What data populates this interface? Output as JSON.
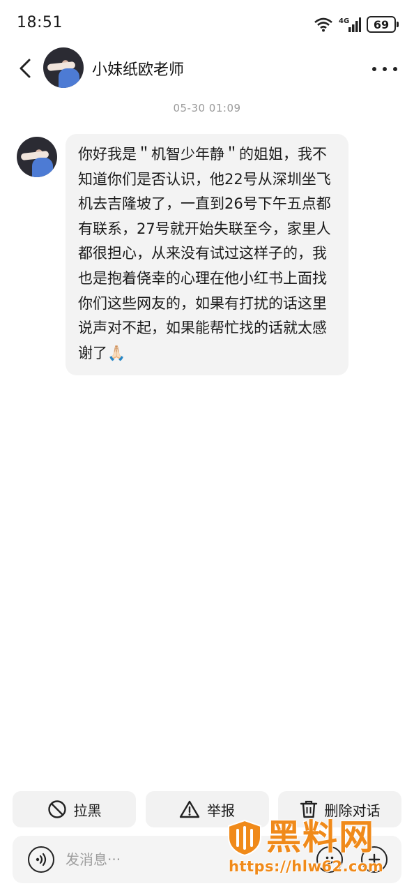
{
  "status_bar": {
    "time": "18:51",
    "signal_text": "4G",
    "battery": "69"
  },
  "header": {
    "contact_name": "小妹纸欧老师",
    "back_icon": "chevron-left-icon",
    "more_icon": "more-horizontal-icon"
  },
  "conversation": {
    "timestamp": "05-30 01:09",
    "messages": [
      {
        "sender": "contact",
        "text": "你好我是＂机智少年静＂的姐姐，我不知道你们是否认识，他22号从深圳坐飞机去吉隆坡了，一直到26号下午五点都有联系，27号就开始失联至今，家里人都很担心，从来没有试过这样子的，我也是抱着侥幸的心理在他小红书上面找你们这些网友的，如果有打扰的话这里说声对不起，如果能帮忙找的话就太感谢了🙏🏻"
      }
    ]
  },
  "actions": {
    "block_label": "拉黑",
    "report_label": "举报",
    "delete_label": "删除对话"
  },
  "input": {
    "placeholder": "发消息···"
  },
  "watermark": {
    "title": "黑料网",
    "url": "https://hlw62.com"
  }
}
